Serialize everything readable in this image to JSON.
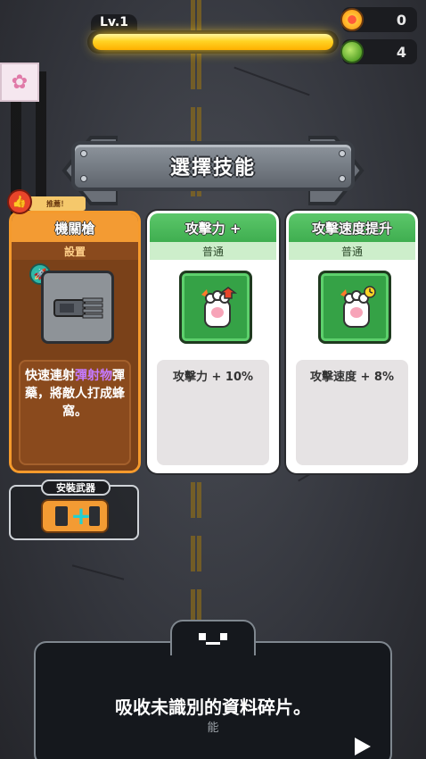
{
  "hud": {
    "level_label": "Lv.1",
    "xp_fraction": 1.0,
    "coin_icon": "coin-icon",
    "coin_count": "0",
    "gem_icon": "zombie-head-icon",
    "gem_count": "4"
  },
  "title": "選擇技能",
  "recommend_label": "推薦！",
  "cards": [
    {
      "name": "機關槍",
      "category": "設置",
      "icon": "gatling-gun-icon",
      "badge_icon": "rocket-badge-icon",
      "desc_before": "快速連射",
      "desc_highlight": "彈射物",
      "desc_after": "彈藥，將敵人打成蜂窩。",
      "theme": "#f39b33"
    },
    {
      "name": "攻擊力 +",
      "category": "普通",
      "icon": "paw-attack-up-icon",
      "desc": "攻擊力 + 10%",
      "theme": "#4fbc5f"
    },
    {
      "name": "攻擊速度提升",
      "category": "普通",
      "icon": "paw-speed-icon",
      "desc": "攻擊速度 + 8%",
      "theme": "#4fbc5f"
    }
  ],
  "install": {
    "label": "安裝武器",
    "icon": "car-plus-icon"
  },
  "dialog": {
    "text": "吸收未識別的資料碎片。",
    "sub": "能",
    "next_icon": "play-arrow-icon"
  },
  "colors": {
    "accent_orange": "#f39b33",
    "accent_green": "#4fbc5f",
    "xp_yellow": "#ffd324",
    "highlight_purple": "#c47aff"
  }
}
